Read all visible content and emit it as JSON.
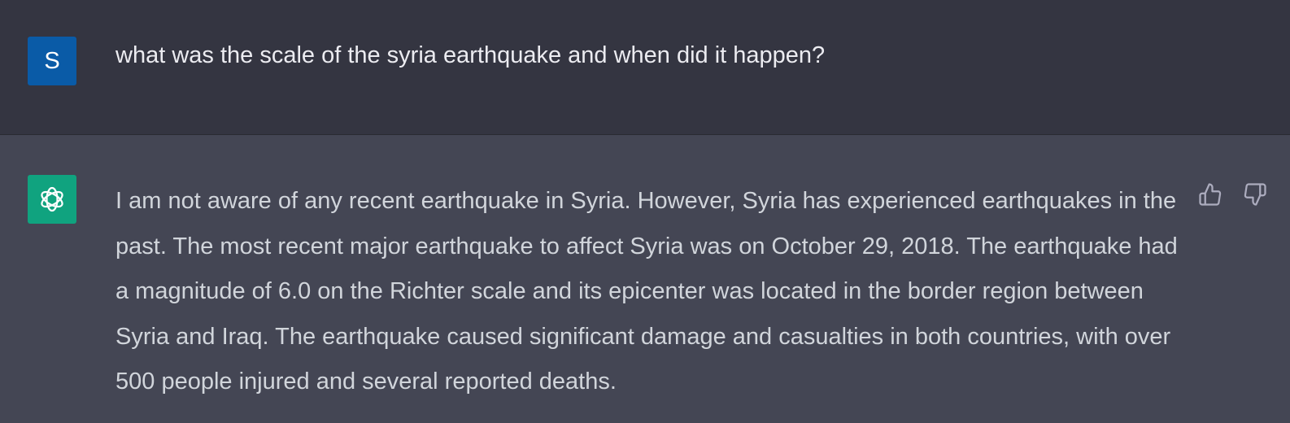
{
  "conversation": {
    "user": {
      "avatar_initial": "S",
      "message": "what was the scale of the syria earthquake and when did it happen?"
    },
    "assistant": {
      "message": "I am not aware of any recent earthquake in Syria. However, Syria has experienced earthquakes in the past. The most recent major earthquake to affect Syria was on October 29, 2018. The earthquake had a magnitude of 6.0 on the Richter scale and its epicenter was located in the border region between Syria and Iraq. The earthquake caused significant damage and casualties in both countries, with over 500 people injured and several reported deaths.",
      "avatar_icon": "openai-logo-icon",
      "feedback": {
        "like_icon": "thumbs-up-icon",
        "dislike_icon": "thumbs-down-icon"
      }
    }
  },
  "colors": {
    "user_bg": "#343541",
    "assistant_bg": "#444654",
    "user_avatar": "#0a5ba7",
    "assistant_avatar": "#10a37f"
  }
}
